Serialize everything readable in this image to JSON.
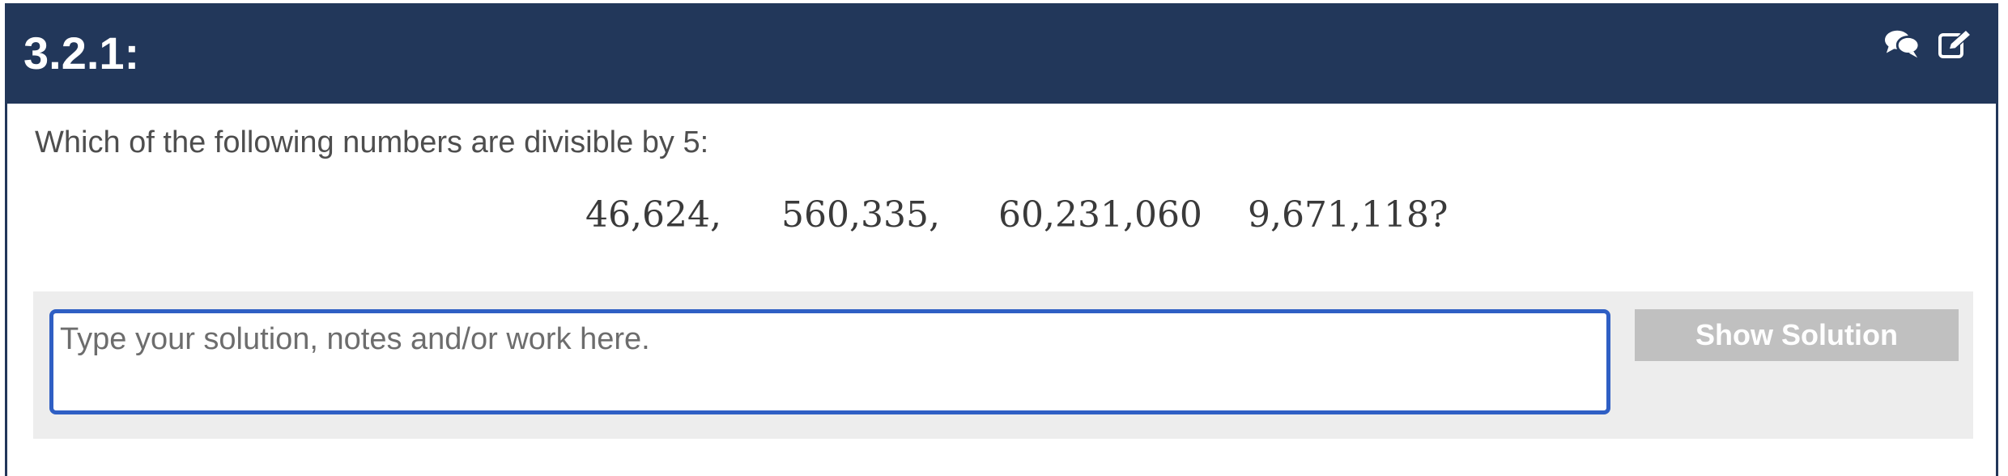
{
  "header": {
    "title": "3.2.1:",
    "icons": [
      "comments-icon",
      "edit-icon"
    ],
    "background_color": "#22375a"
  },
  "question": {
    "prompt": "Which of the following numbers are divisible by 5:",
    "numbers": [
      "46,624,",
      "560,335,",
      "60,231,060",
      "9,671,118?"
    ]
  },
  "answer": {
    "placeholder": "Type your solution, notes and/or work here.",
    "value": "",
    "focus_color": "#2f5fc4"
  },
  "actions": {
    "show_solution_label": "Show Solution",
    "button_color": "#c0c0c0"
  }
}
